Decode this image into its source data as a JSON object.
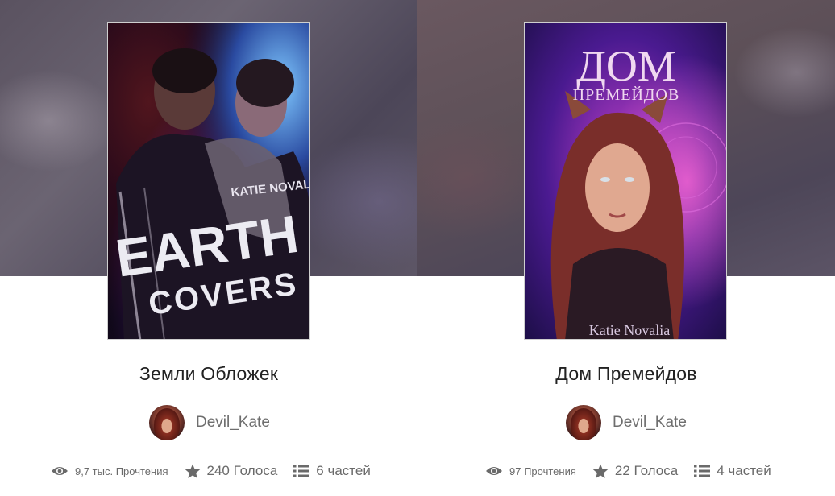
{
  "stories": [
    {
      "title": "Земли Обложек",
      "cover": {
        "author_text": "KATIE NOVALIA",
        "title_line1": "EARTH",
        "title_line2": "COVERS"
      },
      "author": "Devil_Kate",
      "stats": {
        "reads": "9,7 тыс. Прочтения",
        "votes": "240 Голоса",
        "parts": "6 частей"
      }
    },
    {
      "title": "Дом Премейдов",
      "cover": {
        "title_line1": "ДОМ",
        "title_line2": "ПРЕМЕЙДОВ",
        "author_text": "Katie Novalia"
      },
      "author": "Devil_Kate",
      "stats": {
        "reads": "97 Прочтения",
        "votes": "22 Голоса",
        "parts": "4 частей"
      }
    }
  ],
  "icons": {
    "reads": "eye-icon",
    "votes": "star-icon",
    "parts": "list-icon"
  },
  "colors": {
    "text": "#222222",
    "muted": "#6e6e6e",
    "icon": "#6a6a6a"
  }
}
